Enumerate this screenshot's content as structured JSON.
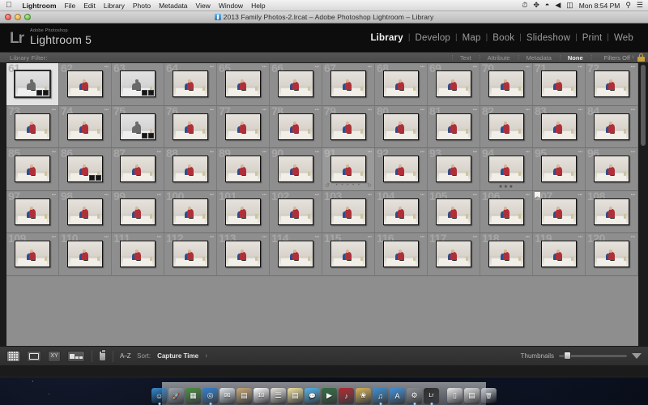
{
  "menubar": {
    "apple_icon": "apple-icon",
    "app_name": "Lightroom",
    "items": [
      "File",
      "Edit",
      "Library",
      "Photo",
      "Metadata",
      "View",
      "Window",
      "Help"
    ],
    "status_icons": [
      "clock-icon",
      "bluetooth-icon",
      "wifi-icon",
      "volume-icon",
      "battery-icon"
    ],
    "clock": "Mon 8:54 PM",
    "search_icon": "spotlight-search-icon",
    "notifications_icon": "notification-center-icon"
  },
  "window": {
    "title": "2013 Family Photos-2.lrcat – Adobe Photoshop Lightroom – Library",
    "close_label": "close-button",
    "minimize_label": "minimize-button",
    "zoom_label": "zoom-button"
  },
  "identity": {
    "logo": "Lr",
    "small_line": "Adobe Photoshop",
    "big_line": "Lightroom 5"
  },
  "modules": {
    "items": [
      "Library",
      "Develop",
      "Map",
      "Book",
      "Slideshow",
      "Print",
      "Web"
    ],
    "active": "Library",
    "separator": "|"
  },
  "filter_bar": {
    "label": "Library Filter:",
    "options": [
      "Text",
      "Attribute",
      "Metadata",
      "None"
    ],
    "active": "None",
    "filters_state": "Filters Off",
    "lock_icon": "lock-icon",
    "caret": "↕"
  },
  "grid": {
    "columns": 12,
    "first_index": 61,
    "selected_index": 61,
    "hover_index": 91,
    "flagged_index": 107,
    "stars_index": 94,
    "stars_count": 3,
    "stars_glyph": "★★★",
    "rating_dots": "• • • • •",
    "rotate_left_icon": "rotate-left-icon",
    "rotate_right_icon": "rotate-right-icon",
    "badge_dots": "•••",
    "mono_indexes": [
      61,
      63,
      75
    ],
    "badge_indexes": [
      63,
      75,
      86
    ],
    "cells": [
      61,
      62,
      63,
      64,
      65,
      66,
      67,
      68,
      69,
      70,
      71,
      72,
      73,
      74,
      75,
      76,
      77,
      78,
      79,
      80,
      81,
      82,
      83,
      84,
      85,
      86,
      87,
      88,
      89,
      90,
      91,
      92,
      93,
      94,
      95,
      96,
      97,
      98,
      99,
      100,
      101,
      102,
      103,
      104,
      105,
      106,
      107,
      108,
      109,
      110,
      111,
      112,
      113,
      114,
      115,
      116,
      117,
      118,
      119,
      120
    ]
  },
  "toolbar": {
    "view_buttons": [
      "grid-view",
      "loupe-view",
      "compare-view",
      "survey-view"
    ],
    "compare_label": "XY",
    "painter_icon": "spray-can-icon",
    "sort_direction": "A–Z",
    "sort_label": "Sort:",
    "sort_value": "Capture Time",
    "sort_caret": "↕",
    "thumbnails_label": "Thumbnails",
    "panel_toggle_icon": "panel-toggle-triangle-icon"
  },
  "dock": {
    "items": [
      {
        "name": "finder",
        "color": "#3b8fd4",
        "glyph": "☺"
      },
      {
        "name": "launchpad",
        "color": "#9aa3ab",
        "glyph": "🚀"
      },
      {
        "name": "app-store-mission",
        "color": "#4a8c3f",
        "glyph": "▦"
      },
      {
        "name": "safari",
        "color": "#2f7fd0",
        "glyph": "◎"
      },
      {
        "name": "mail",
        "color": "#dfe6ec",
        "glyph": "✉"
      },
      {
        "name": "contacts",
        "color": "#c9a878",
        "glyph": "▤"
      },
      {
        "name": "calendar",
        "color": "#ffffff",
        "glyph": "10"
      },
      {
        "name": "reminders",
        "color": "#e8e4dc",
        "glyph": "☰"
      },
      {
        "name": "notes",
        "color": "#f2e3a0",
        "glyph": "▤"
      },
      {
        "name": "messages",
        "color": "#4fb3e8",
        "glyph": "💬"
      },
      {
        "name": "facetime",
        "color": "#2f6e3f",
        "glyph": "▶"
      },
      {
        "name": "itunes-red",
        "color": "#b0272d",
        "glyph": "♪"
      },
      {
        "name": "iphoto",
        "color": "#d8b25a",
        "glyph": "❀"
      },
      {
        "name": "itunes",
        "color": "#3a8ed0",
        "glyph": "♫"
      },
      {
        "name": "app-store",
        "color": "#3f8fd8",
        "glyph": "A"
      },
      {
        "name": "system-preferences",
        "color": "#8b8f94",
        "glyph": "⚙"
      },
      {
        "name": "lightroom",
        "color": "#2b2b2b",
        "glyph": "Lr"
      },
      {
        "name": "documents-stack",
        "color": "#e9e9e9",
        "glyph": "▯"
      },
      {
        "name": "downloads-stack",
        "color": "#dcdcdc",
        "glyph": "▤"
      },
      {
        "name": "trash",
        "color": "#c7cbd0",
        "glyph": "🗑"
      }
    ],
    "separator": "dock-separator"
  }
}
